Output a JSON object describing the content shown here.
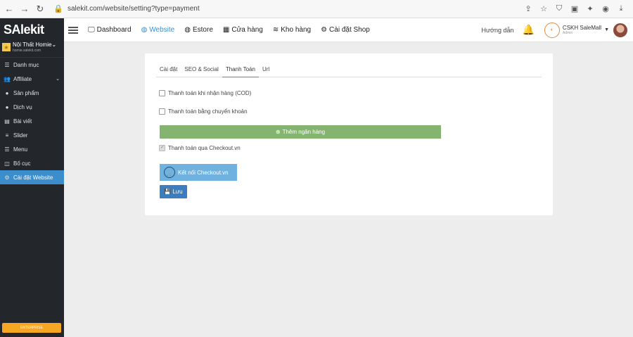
{
  "browser": {
    "url": "salekit.com/website/setting?type=payment"
  },
  "sidebar": {
    "logo": "SAlekit",
    "shop_name": "Nội Thất Homie",
    "shop_url": "homie.salekit.com",
    "items": [
      {
        "label": "Danh mục",
        "icon": "list-icon"
      },
      {
        "label": "Affiliate",
        "icon": "users-icon"
      },
      {
        "label": "Sản phẩm",
        "icon": "product-icon"
      },
      {
        "label": "Dịch vụ",
        "icon": "service-icon"
      },
      {
        "label": "Bài viết",
        "icon": "newspaper-icon"
      },
      {
        "label": "Slider",
        "icon": "sliders-icon"
      },
      {
        "label": "Menu",
        "icon": "menu-icon"
      },
      {
        "label": "Bố cục",
        "icon": "layout-icon"
      },
      {
        "label": "Cài đặt Website",
        "icon": "gear-icon"
      }
    ],
    "bottom_badge": "ENTERPRISE"
  },
  "topnav": {
    "items": [
      {
        "label": "Dashboard",
        "icon": "monitor-icon"
      },
      {
        "label": "Website",
        "icon": "globe-icon"
      },
      {
        "label": "Estore",
        "icon": "globe-icon"
      },
      {
        "label": "Cửa hàng",
        "icon": "store-icon"
      },
      {
        "label": "Kho hàng",
        "icon": "database-icon"
      },
      {
        "label": "Cài đặt Shop",
        "icon": "gear-icon"
      }
    ],
    "help": "Hướng dẫn",
    "user_name": "CSKH SaleMall",
    "user_role": "Admin"
  },
  "card": {
    "tabs": [
      "Cài đặt",
      "SEO & Social",
      "Thanh Toán",
      "Url"
    ],
    "cod_label": "Thanh toán khi nhận hàng (COD)",
    "bank_label": "Thanh toán bằng chuyển khoản",
    "add_bank_label": "Thêm ngân hàng",
    "checkout_label": "Thanh toán qua Checkout.vn",
    "connect_label": "Kết nối Checkout.vn",
    "save_label": "Lưu"
  },
  "colors": {
    "sidebar_bg": "#23262b",
    "accent": "#3c8dcb",
    "add_bank": "#84b46f",
    "connect": "#6fb2e0",
    "save": "#3c7dbf"
  }
}
